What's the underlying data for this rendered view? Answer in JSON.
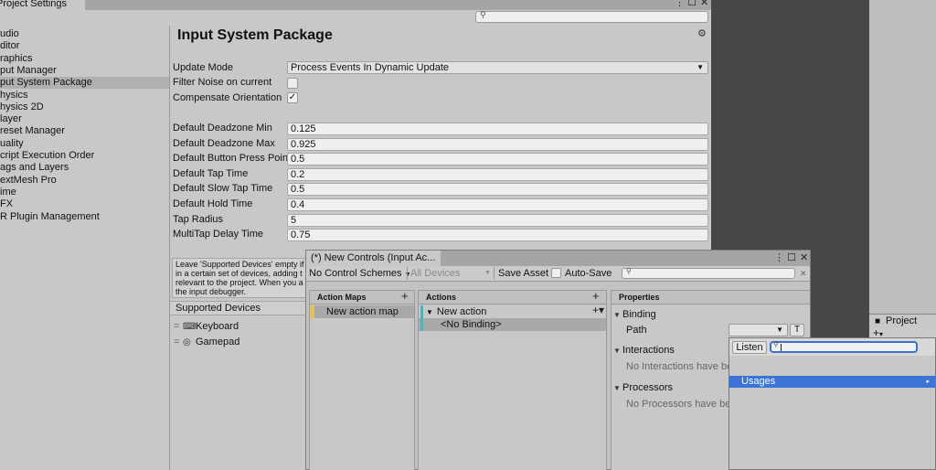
{
  "project_settings": {
    "tab_title": "Project Settings",
    "search_placeholder": "",
    "sidebar": [
      {
        "label": "udio",
        "selected": false
      },
      {
        "label": "ditor",
        "selected": false
      },
      {
        "label": "raphics",
        "selected": false
      },
      {
        "label": "put Manager",
        "selected": false
      },
      {
        "label": "put System Package",
        "selected": true
      },
      {
        "label": "hysics",
        "selected": false
      },
      {
        "label": "hysics 2D",
        "selected": false
      },
      {
        "label": "layer",
        "selected": false
      },
      {
        "label": "reset Manager",
        "selected": false
      },
      {
        "label": "uality",
        "selected": false
      },
      {
        "label": "cript Execution Order",
        "selected": false
      },
      {
        "label": "ags and Layers",
        "selected": false
      },
      {
        "label": "extMesh Pro",
        "selected": false
      },
      {
        "label": "ime",
        "selected": false
      },
      {
        "label": "FX",
        "selected": false
      },
      {
        "label": "R Plugin Management",
        "selected": false
      }
    ],
    "heading": "Input System Package",
    "update_mode": {
      "label": "Update Mode",
      "value": "Process Events In Dynamic Update"
    },
    "filter_noise": {
      "label": "Filter Noise on current",
      "checked": false
    },
    "compensate_orientation": {
      "label": "Compensate Orientation",
      "checked": true,
      "check_glyph": "✓"
    },
    "numeric_fields": [
      {
        "label": "Default Deadzone Min",
        "value": "0.125"
      },
      {
        "label": "Default Deadzone Max",
        "value": "0.925"
      },
      {
        "label": "Default Button Press Point",
        "value": "0.5"
      },
      {
        "label": "Default Tap Time",
        "value": "0.2"
      },
      {
        "label": "Default Slow Tap Time",
        "value": "0.5"
      },
      {
        "label": "Default Hold Time",
        "value": "0.4"
      },
      {
        "label": "Tap Radius",
        "value": "5"
      },
      {
        "label": "MultiTap Delay Time",
        "value": "0.75"
      }
    ],
    "help_lines": [
      "Leave 'Supported Devices' empty if",
      "in a certain set of devices, adding t",
      "relevant to the project. When you a",
      "the input debugger."
    ],
    "supported_devices": {
      "header": "Supported Devices",
      "items": [
        {
          "label": "Keyboard",
          "icon": "keyboard-icon",
          "glyph": "⌨"
        },
        {
          "label": "Gamepad",
          "icon": "gamepad-icon",
          "glyph": "◎"
        }
      ]
    }
  },
  "input_actions": {
    "tab_title": "(*) New Controls (Input Ac...",
    "toolbar": {
      "control_scheme": "No Control Schemes",
      "devices": "All Devices",
      "save_asset": "Save Asset",
      "auto_save": "Auto-Save"
    },
    "action_maps": {
      "header": "Action Maps",
      "items": [
        {
          "label": "New action map",
          "selected": true
        }
      ]
    },
    "actions": {
      "header": "Actions",
      "items": [
        {
          "label": "New action",
          "type": "action"
        },
        {
          "label": "<No Binding>",
          "type": "binding",
          "selected": true
        }
      ]
    },
    "properties": {
      "header": "Properties",
      "binding": "Binding",
      "path_label": "Path",
      "t_button": "T",
      "interactions": "Interactions",
      "interactions_empty": "No Interactions have be",
      "processors": "Processors",
      "processors_empty": "No Processors have bee"
    }
  },
  "project_window": {
    "tab_title": "Project",
    "add_glyph": "+",
    "add_arrow": "▾"
  },
  "binding_popup": {
    "listen": "Listen",
    "search_value": "",
    "rows": [
      {
        "label": "Usages",
        "highlighted": true,
        "submenu_glyph": "▸"
      }
    ]
  },
  "colors": {
    "accent_selection": "#3b74d6",
    "map_marker": "#e6c44a",
    "action_marker": "#58b0b8",
    "search_focus": "#3a72c9"
  },
  "glyphs": {
    "kebab": "⋮",
    "maximize": "☐",
    "close": "✕",
    "gear": "⚙",
    "search": "⚲",
    "dropdown_arrow": "▼",
    "fold_open": "▼",
    "plus": "+",
    "plus_dropdown": "+▾",
    "handle": "="
  }
}
